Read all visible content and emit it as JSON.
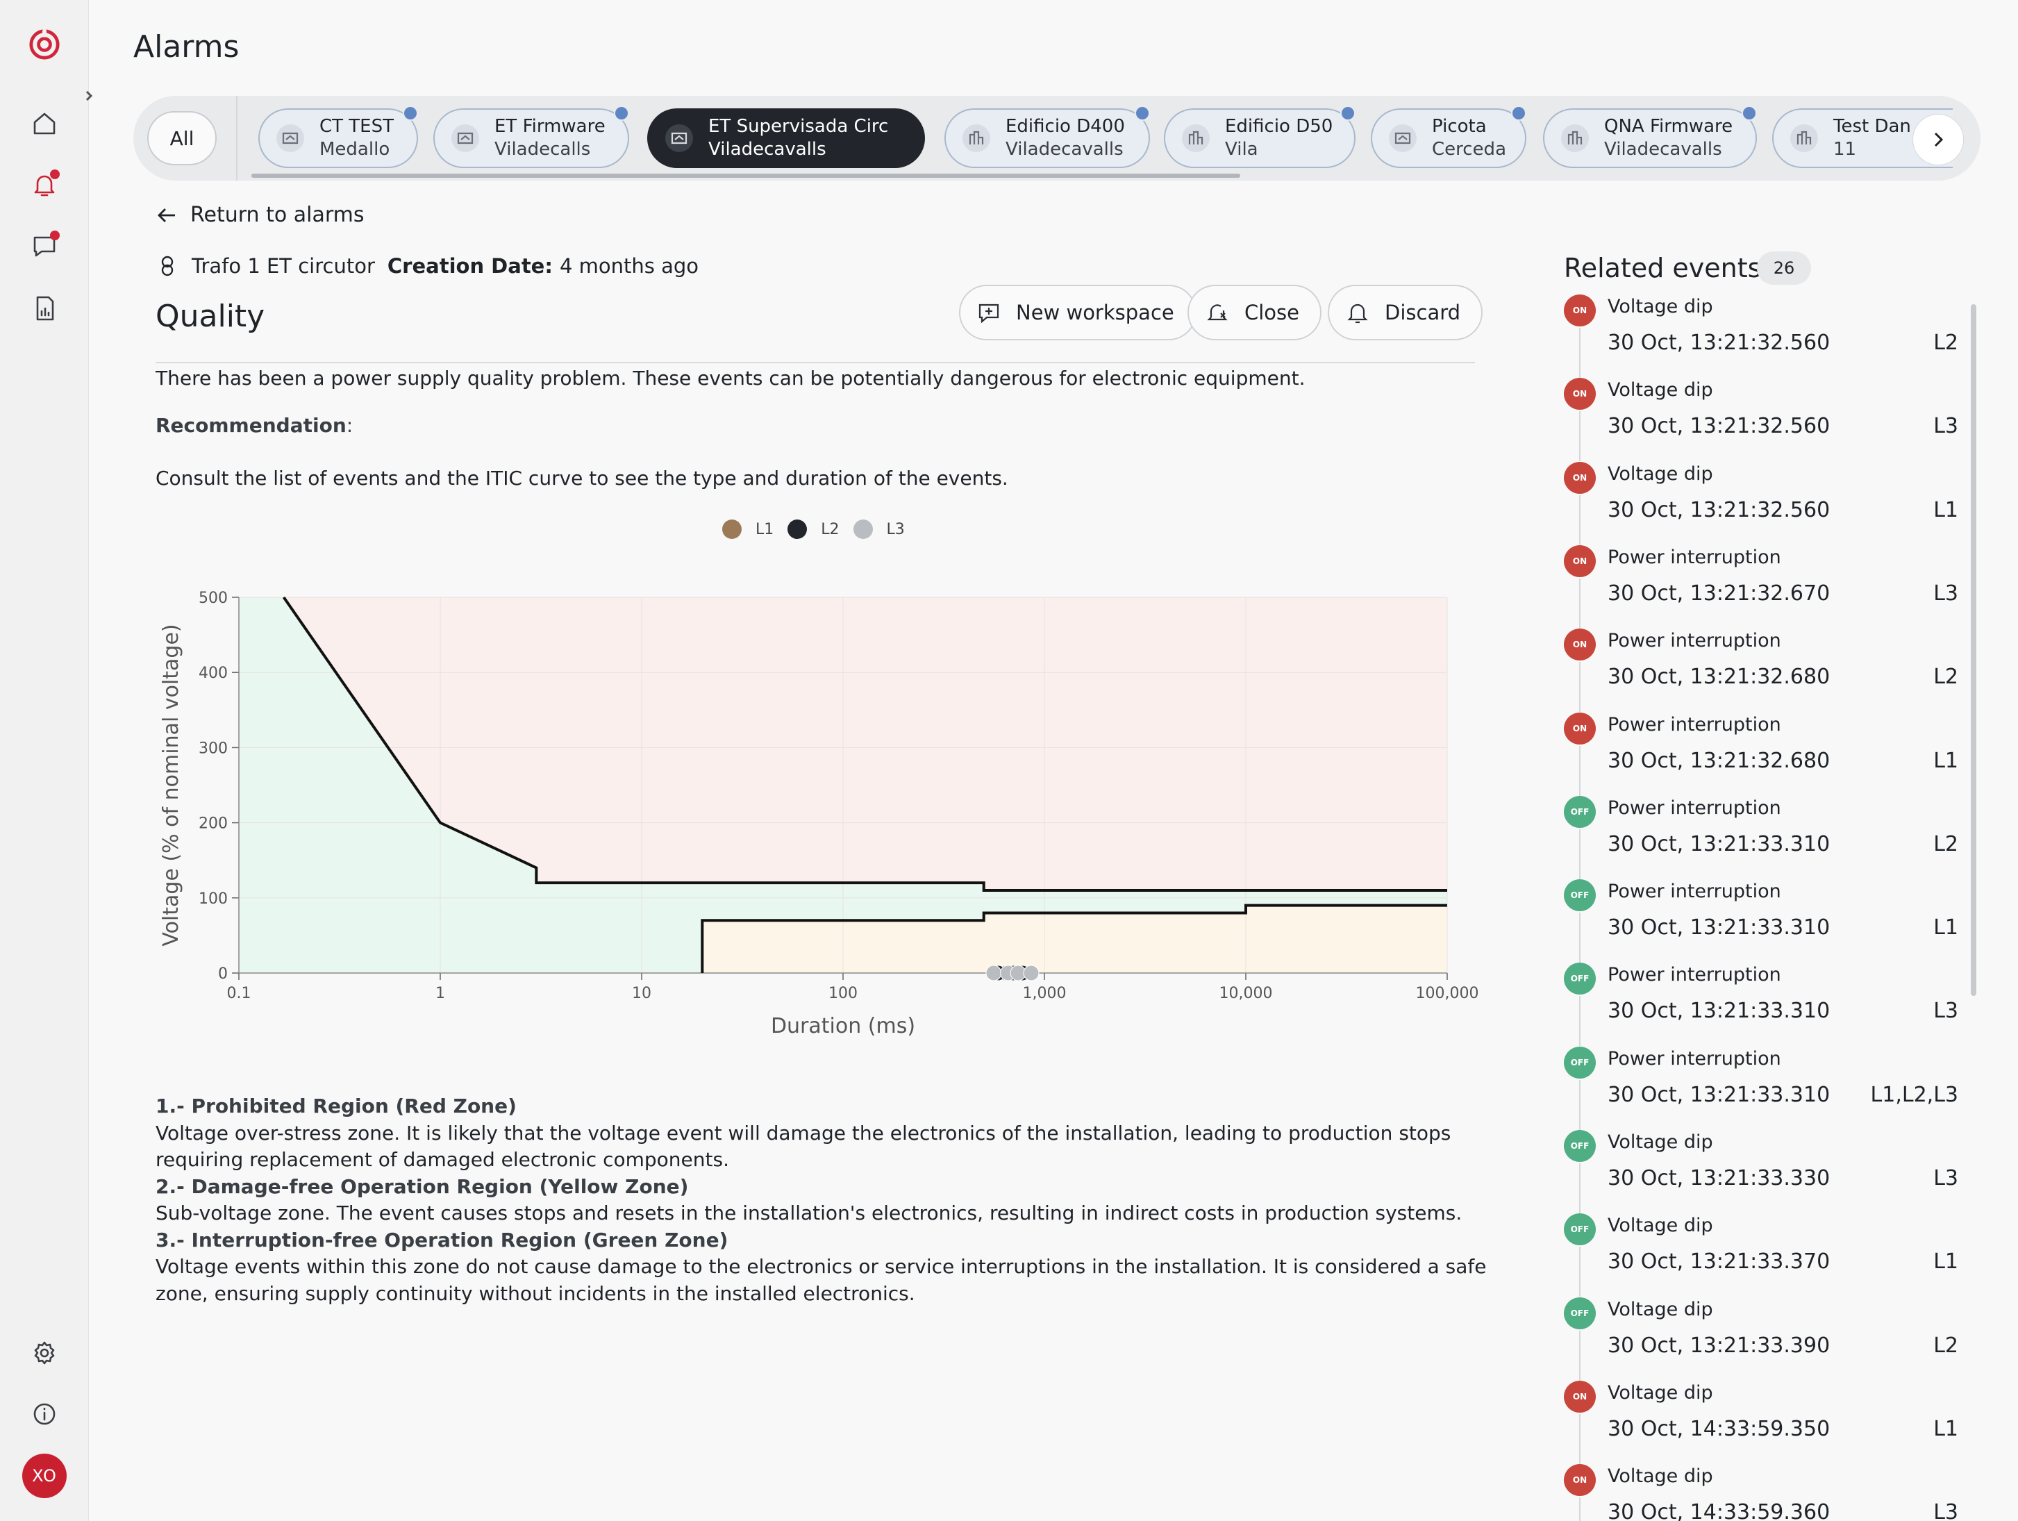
{
  "app": {
    "page_title": "Alarms",
    "user_initials": "XO"
  },
  "tabs": {
    "all_label": "All",
    "items": [
      {
        "name": "CT TEST",
        "location": "Medallo",
        "icon": "transformer-icon",
        "active": false,
        "notified": true
      },
      {
        "name": "ET Firmware",
        "location": "Viladecalls",
        "icon": "transformer-icon",
        "active": false,
        "notified": true
      },
      {
        "name": "ET Supervisada Circ",
        "location": "Viladecavalls",
        "icon": "transformer-icon",
        "active": true,
        "notified": false
      },
      {
        "name": "Edificio D400",
        "location": "Viladecavalls",
        "icon": "building-icon",
        "active": false,
        "notified": true
      },
      {
        "name": "Edificio D50",
        "location": "Vila",
        "icon": "building-icon",
        "active": false,
        "notified": true
      },
      {
        "name": "Picota",
        "location": "Cerceda",
        "icon": "transformer-icon",
        "active": false,
        "notified": true
      },
      {
        "name": "QNA Firmware",
        "location": "Viladecavalls",
        "icon": "building-icon",
        "active": false,
        "notified": true
      },
      {
        "name": "Test Dan",
        "location": "11",
        "icon": "building-icon",
        "active": false,
        "notified": false
      }
    ]
  },
  "detail": {
    "back_label": "Return to alarms",
    "device": "Trafo 1 ET circutor",
    "creation_label": "Creation Date:",
    "creation_value": "4 months ago",
    "section_title": "Quality",
    "actions": {
      "new_workspace": "New workspace",
      "close": "Close",
      "discard": "Discard"
    },
    "description": "There has been a power supply quality problem. These events can be potentially dangerous for electronic equipment.",
    "recommendation_label": "Recommendation",
    "recommendation_colon": ":",
    "consult": "Consult the list of events and the ITIC curve to see the type and duration of the events.",
    "zones": [
      {
        "title": "1.- Prohibited Region (Red Zone)",
        "text": "Voltage over-stress zone. It is likely that the voltage event will damage the electronics of the installation, leading to production stops requiring replacement of damaged electronic components."
      },
      {
        "title": "2.- Damage-free Operation Region (Yellow Zone)",
        "text": "Sub-voltage zone. The event causes stops and resets in the installation's electronics, resulting in indirect costs in production systems."
      },
      {
        "title": "3.- Interruption-free Operation Region (Green Zone)",
        "text": "Voltage events within this zone do not cause damage to the electronics or service interruptions in the installation. It is considered a safe zone, ensuring supply continuity without incidents in the installed electronics."
      }
    ]
  },
  "chart_data": {
    "type": "scatter",
    "xlabel": "Duration (ms)",
    "ylabel": "Voltage (% of nominal voltage)",
    "xscale": "log",
    "xlim": [
      0.1,
      100000
    ],
    "ylim": [
      0,
      500
    ],
    "x_ticks": [
      "0.1",
      "1",
      "10",
      "100",
      "1,000",
      "10,000",
      "100,000"
    ],
    "y_ticks": [
      "0",
      "100",
      "200",
      "300",
      "400",
      "500"
    ],
    "legend": [
      {
        "name": "L1",
        "color": "#9c7a58"
      },
      {
        "name": "L2",
        "color": "#22262c"
      },
      {
        "name": "L3",
        "color": "#b9bcc0"
      }
    ],
    "upper_curve": [
      [
        0.167,
        500
      ],
      [
        1,
        200
      ],
      [
        3,
        140
      ],
      [
        3,
        120
      ],
      [
        500,
        120
      ],
      [
        500,
        110
      ],
      [
        100000,
        110
      ]
    ],
    "lower_curve": [
      [
        20,
        0
      ],
      [
        20,
        70
      ],
      [
        500,
        70
      ],
      [
        500,
        80
      ],
      [
        10000,
        80
      ],
      [
        10000,
        90
      ],
      [
        100000,
        90
      ]
    ],
    "zones": {
      "red": "#fbefee",
      "green": "#e9f7f1",
      "yellow": "#fdf6e8"
    },
    "series": [
      {
        "name": "L1",
        "points": [
          [
            610,
            0
          ],
          [
            640,
            0
          ]
        ]
      },
      {
        "name": "L2",
        "points": [
          [
            590,
            0
          ],
          [
            700,
            0
          ],
          [
            780,
            0
          ]
        ]
      },
      {
        "name": "L3",
        "points": [
          [
            560,
            0
          ],
          [
            660,
            0
          ],
          [
            740,
            0
          ],
          [
            860,
            0
          ]
        ]
      }
    ]
  },
  "related": {
    "title": "Related events",
    "count": "26",
    "events": [
      {
        "state": "ON",
        "type": "Voltage dip",
        "time": "30 Oct, 13:21:32.560",
        "phase": "L2"
      },
      {
        "state": "ON",
        "type": "Voltage dip",
        "time": "30 Oct, 13:21:32.560",
        "phase": "L3"
      },
      {
        "state": "ON",
        "type": "Voltage dip",
        "time": "30 Oct, 13:21:32.560",
        "phase": "L1"
      },
      {
        "state": "ON",
        "type": "Power interruption",
        "time": "30 Oct, 13:21:32.670",
        "phase": "L3"
      },
      {
        "state": "ON",
        "type": "Power interruption",
        "time": "30 Oct, 13:21:32.680",
        "phase": "L2"
      },
      {
        "state": "ON",
        "type": "Power interruption",
        "time": "30 Oct, 13:21:32.680",
        "phase": "L1"
      },
      {
        "state": "OFF",
        "type": "Power interruption",
        "time": "30 Oct, 13:21:33.310",
        "phase": "L2"
      },
      {
        "state": "OFF",
        "type": "Power interruption",
        "time": "30 Oct, 13:21:33.310",
        "phase": "L1"
      },
      {
        "state": "OFF",
        "type": "Power interruption",
        "time": "30 Oct, 13:21:33.310",
        "phase": "L3"
      },
      {
        "state": "OFF",
        "type": "Power interruption",
        "time": "30 Oct, 13:21:33.310",
        "phase": "L1,L2,L3"
      },
      {
        "state": "OFF",
        "type": "Voltage dip",
        "time": "30 Oct, 13:21:33.330",
        "phase": "L3"
      },
      {
        "state": "OFF",
        "type": "Voltage dip",
        "time": "30 Oct, 13:21:33.370",
        "phase": "L1"
      },
      {
        "state": "OFF",
        "type": "Voltage dip",
        "time": "30 Oct, 13:21:33.390",
        "phase": "L2"
      },
      {
        "state": "ON",
        "type": "Voltage dip",
        "time": "30 Oct, 14:33:59.350",
        "phase": "L1"
      },
      {
        "state": "ON",
        "type": "Voltage dip",
        "time": "30 Oct, 14:33:59.360",
        "phase": "L3"
      }
    ]
  }
}
